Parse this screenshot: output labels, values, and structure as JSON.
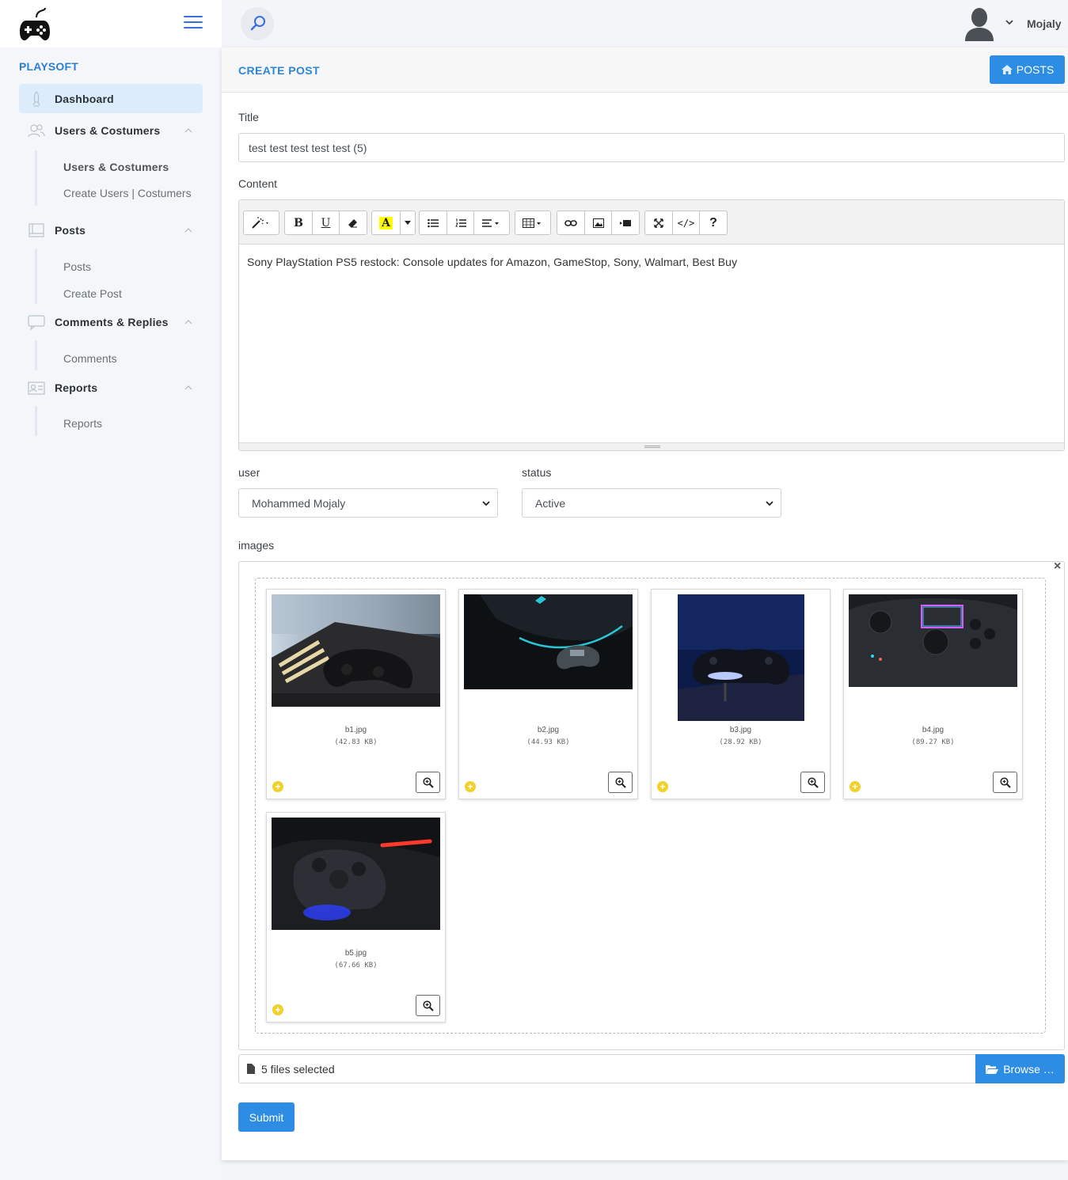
{
  "sidebar": {
    "brand": "PLAYSOFT",
    "nav": [
      {
        "label": "Dashboard",
        "icon": "rocket-icon"
      },
      {
        "label": "Users & Costumers",
        "icon": "users-icon",
        "children": [
          "Users & Costumers",
          "Create Users | Costumers"
        ]
      },
      {
        "label": "Posts",
        "icon": "book-icon",
        "children": [
          "Posts",
          "Create Post"
        ]
      },
      {
        "label": "Comments & Replies",
        "icon": "comment-icon",
        "children": [
          "Comments"
        ]
      },
      {
        "label": "Reports",
        "icon": "id-card-icon",
        "children": [
          "Reports"
        ]
      }
    ]
  },
  "topbar": {
    "user_name": "Mojaly"
  },
  "page": {
    "title": "CREATE POST",
    "posts_button": "POSTS"
  },
  "form": {
    "title_label": "Title",
    "title_value": "test test test test test (5)",
    "content_label": "Content",
    "content_value": "Sony PlayStation PS5 restock: Console updates for Amazon, GameStop, Sony, Walmart, Best Buy",
    "user_label": "user",
    "user_value": "Mohammed Mojaly",
    "status_label": "status",
    "status_value": "Active",
    "images_label": "images",
    "images": [
      {
        "name": "b1.jpg",
        "size": "(42.83 KB)"
      },
      {
        "name": "b2.jpg",
        "size": "(44.93 KB)"
      },
      {
        "name": "b3.jpg",
        "size": "(28.92 KB)"
      },
      {
        "name": "b4.jpg",
        "size": "(89.27 KB)"
      },
      {
        "name": "b5.jpg",
        "size": "(67.66 KB)"
      }
    ],
    "files_selected": "5 files selected",
    "browse_label": "Browse …",
    "submit_label": "Submit"
  },
  "colors": {
    "accent": "#2d8ce3",
    "brand": "#2d7fd3",
    "active_nav_bg": "#dcecfb"
  }
}
